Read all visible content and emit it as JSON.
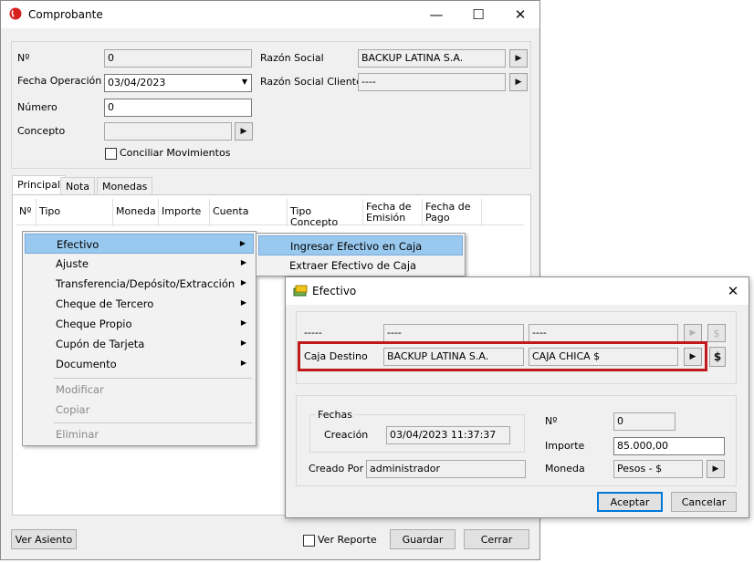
{
  "main_window": {
    "title": "Comprobante",
    "labels": {
      "numero_sign": "Nº",
      "fecha_operacion": "Fecha Operación",
      "numero": "Número",
      "concepto": "Concepto",
      "razon_social": "Razón Social",
      "razon_social_cliente": "Razón Social Cliente",
      "conciliar": "Conciliar Movimientos"
    },
    "values": {
      "numero_sign": "0",
      "fecha_operacion": "03/04/2023",
      "numero": "0",
      "concepto": "",
      "razon_social": "BACKUP LATINA S.A.",
      "razon_social_cliente": "----"
    },
    "tabs": [
      "Principal",
      "Nota",
      "Monedas"
    ],
    "columns": [
      "Nº",
      "Tipo",
      "Moneda",
      "Importe",
      "Cuenta",
      "Tipo Concepto",
      "Fecha de Emisión",
      "Fecha de Pago"
    ],
    "buttons": {
      "ver_asiento": "Ver Asiento",
      "ver_reporte": "Ver Reporte",
      "guardar": "Guardar",
      "cerrar": "Cerrar"
    }
  },
  "context_menu": {
    "items": [
      "Efectivo",
      "Ajuste",
      "Transferencia/Depósito/Extracción",
      "Cheque de Tercero",
      "Cheque Propio",
      "Cupón de Tarjeta",
      "Documento"
    ],
    "disabled_items": [
      "Modificar",
      "Copiar",
      "Eliminar"
    ]
  },
  "submenu": {
    "items": [
      "Ingresar Efectivo en Caja",
      "Extraer Efectivo de Caja"
    ]
  },
  "dialog": {
    "title": "Efectivo",
    "row1": {
      "label": "-----",
      "field1": "----",
      "field2": "----"
    },
    "row2": {
      "label": "Caja Destino",
      "field1": "BACKUP LATINA S.A.",
      "field2": "CAJA CHICA $"
    },
    "dollar": "$",
    "fechas_group": "Fechas",
    "labels": {
      "creacion": "Creación",
      "creado_por": "Creado Por",
      "numero_sign": "Nº",
      "importe": "Importe",
      "moneda": "Moneda"
    },
    "values": {
      "creacion": "03/04/2023 11:37:37",
      "creado_por": "administrador",
      "numero_sign": "0",
      "importe": "85.000,00",
      "moneda": "Pesos - $"
    },
    "buttons": {
      "aceptar": "Aceptar",
      "cancelar": "Cancelar"
    }
  },
  "colors": {
    "highlight": "#99c9ef",
    "focus_border": "#c0181b",
    "accent": "#0078d7"
  }
}
